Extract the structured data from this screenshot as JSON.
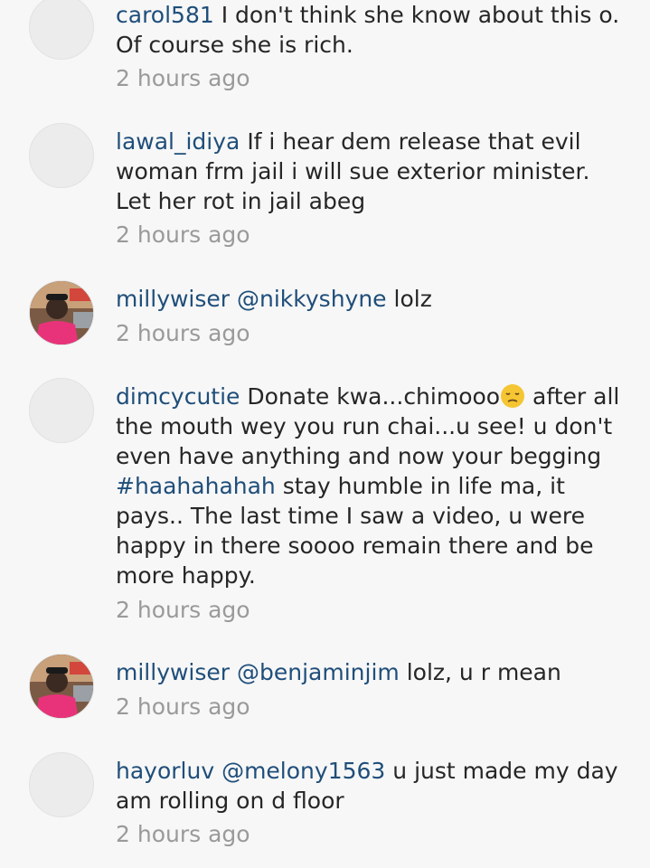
{
  "comments": [
    {
      "username": "carol581",
      "text": "I don't think she know about this o. Of course she is rich.",
      "time": "2 hours ago",
      "avatar": "default-avatar"
    },
    {
      "username": "lawal_idiya",
      "text": "If i hear dem release that evil woman frm jail i will sue exterior minister. Let her rot in jail abeg",
      "time": "2 hours ago",
      "avatar": "default-avatar"
    },
    {
      "username": "millywiser",
      "mention": "@nikkyshyne",
      "text": "lolz",
      "time": "2 hours ago",
      "avatar": "photo-avatar"
    },
    {
      "username": "dimcycutie",
      "text_before_emoji": "Donate kwa...chimooo",
      "text_after_emoji": "after all the mouth wey you run chai...u see! u don't even have anything and now your begging",
      "hashtag": "#haahahahah",
      "text_after_hashtag": "stay humble in life ma, it pays.. The last time I saw a video, u were happy in there soooo remain there and be more happy.",
      "emoji": "pensive-face-emoji",
      "time": "2 hours ago",
      "avatar": "default-avatar"
    },
    {
      "username": "millywiser",
      "mention": "@benjaminjim",
      "text": "lolz, u r mean",
      "time": "2 hours ago",
      "avatar": "photo-avatar"
    },
    {
      "username": "hayorluv",
      "mention": "@melony1563",
      "text": "u just made my day am rolling on d floor",
      "time": "2 hours ago",
      "avatar": "default-avatar"
    }
  ],
  "colors": {
    "username": "#1f4e7a",
    "text": "#262626",
    "timestamp": "#9a9a9a",
    "background": "#f7f7f7"
  }
}
